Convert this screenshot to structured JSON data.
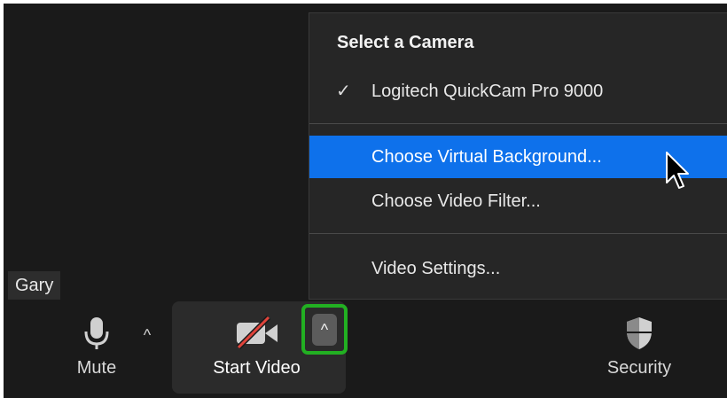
{
  "participant": {
    "name": "Gary"
  },
  "toolbar": {
    "mute_label": "Mute",
    "mute_caret": "^",
    "start_video_label": "Start Video",
    "video_caret": "^",
    "security_label": "Security"
  },
  "camera_menu": {
    "header": "Select a Camera",
    "check_mark": "✓",
    "camera": "Logitech QuickCam Pro 9000",
    "virtual_background": "Choose Virtual Background...",
    "video_filter": "Choose Video Filter...",
    "video_settings": "Video Settings..."
  },
  "colors": {
    "highlight": "#0e71eb",
    "focus_ring": "#22b022",
    "video_off_slash": "#e0443b"
  },
  "icons": [
    "microphone-icon",
    "video-off-icon",
    "shield-icon",
    "check-icon",
    "mouse-cursor-icon"
  ]
}
